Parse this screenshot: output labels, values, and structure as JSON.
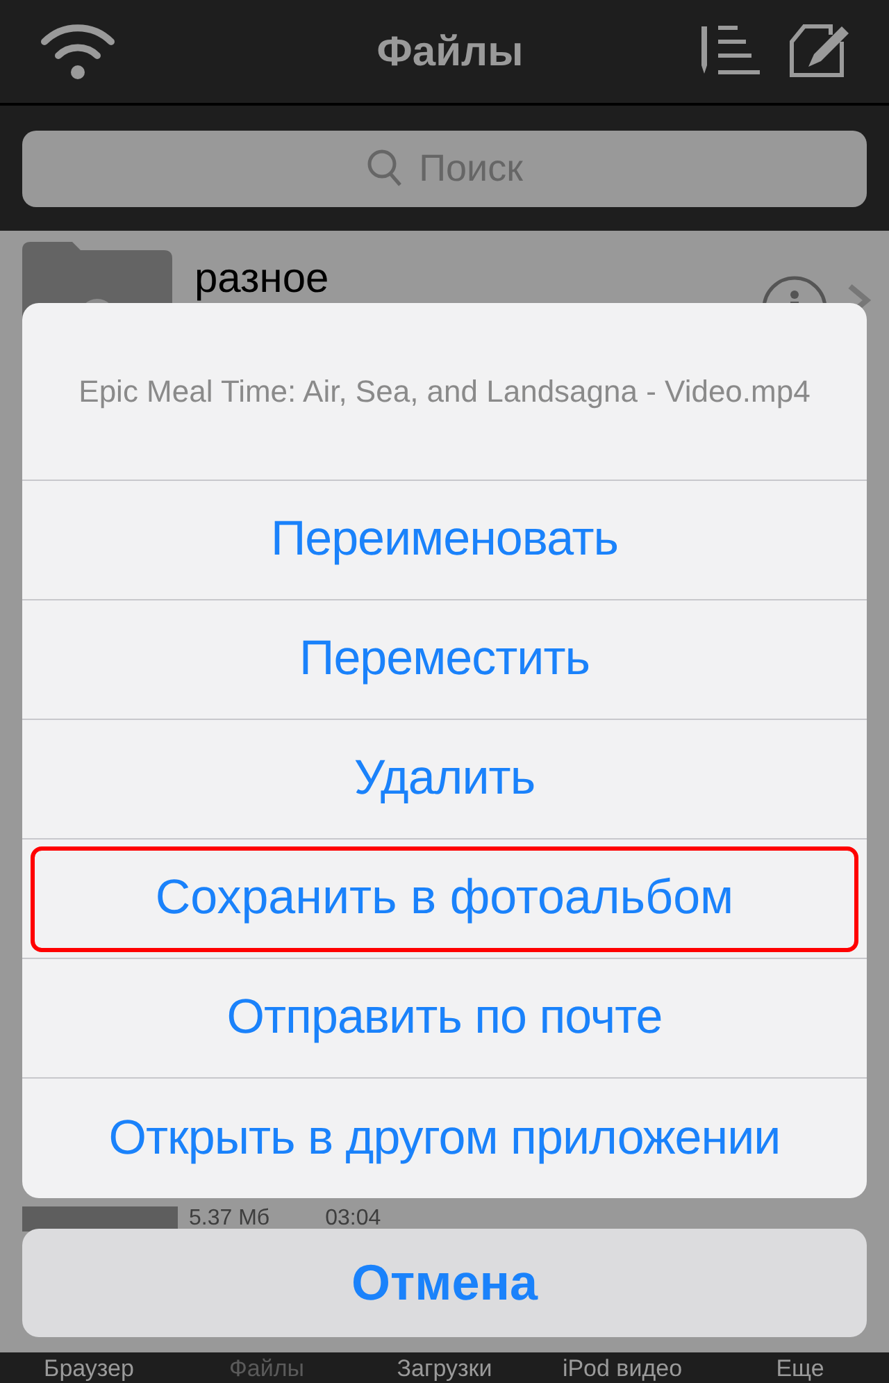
{
  "nav_bar": {
    "title": "Файлы"
  },
  "search": {
    "placeholder": "Поиск"
  },
  "files": [
    {
      "kind": "folder",
      "name": "разное"
    },
    {
      "kind": "video",
      "size": "5.37 Мб",
      "duration": "03:04"
    }
  ],
  "action_sheet": {
    "title": "Epic Meal Time: Air, Sea, and Landsagna - Video.mp4",
    "actions": [
      {
        "label": "Переименовать",
        "highlighted": false
      },
      {
        "label": "Переместить",
        "highlighted": false
      },
      {
        "label": "Удалить",
        "highlighted": false
      },
      {
        "label": "Сохранить в фотоальбом",
        "highlighted": true
      },
      {
        "label": "Отправить по почте",
        "highlighted": false
      },
      {
        "label": "Открыть в другом приложении",
        "highlighted": false
      }
    ],
    "cancel": "Отмена"
  },
  "tab_bar": [
    {
      "label": "Браузер",
      "selected": false
    },
    {
      "label": "Файлы",
      "selected": true
    },
    {
      "label": "Загрузки",
      "selected": false
    },
    {
      "label": "iPod видео",
      "selected": false
    },
    {
      "label": "Еще",
      "selected": false
    }
  ]
}
